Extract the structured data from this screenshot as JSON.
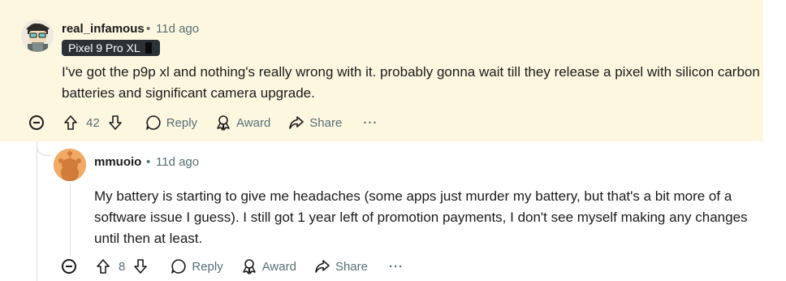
{
  "comments": [
    {
      "author": "real_infamous",
      "time": "11d ago",
      "flair": "Pixel 9 Pro XL",
      "body": "I've got the p9p xl and nothing's really wrong with it. probably gonna wait till they release a pixel with silicon carbon batteries and significant camera upgrade.",
      "votes": "42",
      "reply_label": "Reply",
      "award_label": "Award",
      "share_label": "Share",
      "more_label": "···",
      "highlight_color": "#fdf7e0"
    },
    {
      "author": "mmuoio",
      "time": "11d ago",
      "body": "My battery is starting to give me headaches (some apps just murder my battery, but that's a bit more of a software issue I guess). I still got 1 year left of promotion payments, I don't see myself making any changes until then at least.",
      "votes": "8",
      "reply_label": "Reply",
      "award_label": "Award",
      "share_label": "Share",
      "more_label": "···"
    }
  ],
  "separator": "•",
  "icons": {
    "collapse": "collapse-icon",
    "upvote": "upvote-icon",
    "downvote": "downvote-icon",
    "reply": "reply-icon",
    "award": "award-icon",
    "share": "share-icon"
  },
  "colors": {
    "meta": "#576f76",
    "text": "#1a1a1b",
    "flair_bg": "#2a3236"
  }
}
